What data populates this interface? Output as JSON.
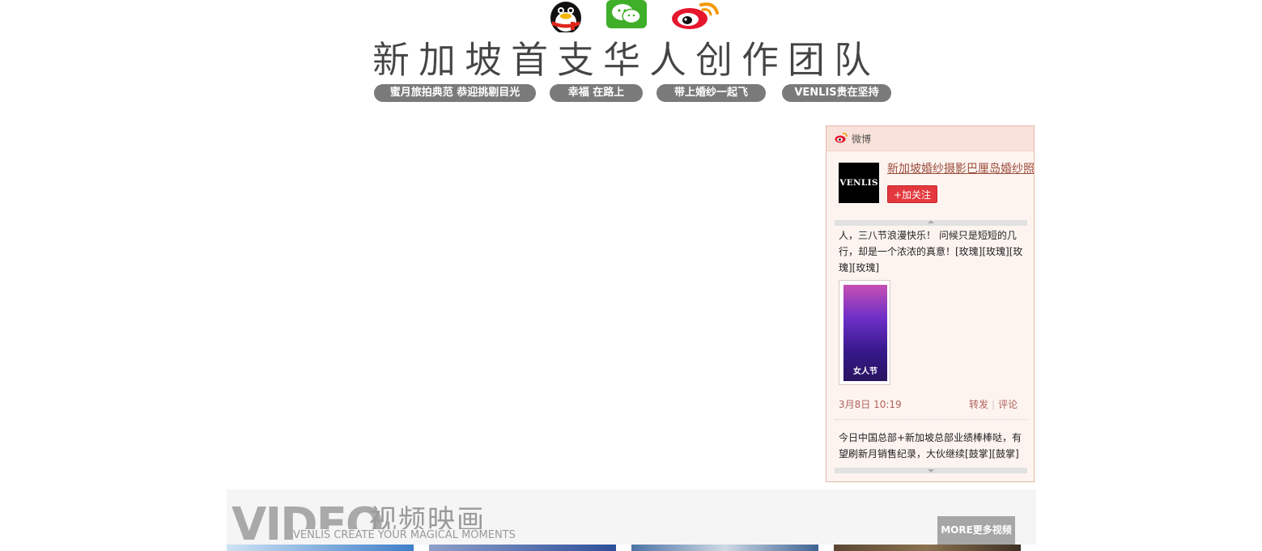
{
  "social": {
    "icons": [
      "qq-penguin-icon",
      "wechat-icon",
      "weibo-icon"
    ]
  },
  "header": {
    "title": "新加坡首支华人创作团队",
    "tags": [
      "蜜月旅拍典范 恭迎挑剔目光",
      "幸福 在路上",
      "带上婚纱一起飞",
      "VENLIS贵在坚持"
    ]
  },
  "weibo": {
    "label": "微博",
    "avatar_text": "VENLIS",
    "account_name": "新加坡婚纱摄影巴厘岛婚纱照",
    "follow_label": "+加关注",
    "post1_text": "人，三八节浪漫快乐！ 问候只是短短的几行，却是一个浓浓的真意！[玫瑰][玫瑰][玫瑰][玫瑰]",
    "post1_thumb_caption": "女人节",
    "post1_date": "3月8日 10:19",
    "repost_label": "转发",
    "comment_label": "评论",
    "post2_text": "今日中国总部+新加坡总部业绩棒棒哒，有望刷新月销售纪录，大伙继续[鼓掌][鼓掌]"
  },
  "video": {
    "big_text": "VIDEO",
    "title_cn": "视频映画",
    "subtitle": "VENLIS CREATE YOUR MAGICAL MOMENTS",
    "more_label": "MORE更多视频"
  },
  "colors": {
    "pill_bg": "#7a7a7a",
    "weibo_border": "#e7b8a8",
    "follow_red": "#e3383e"
  }
}
